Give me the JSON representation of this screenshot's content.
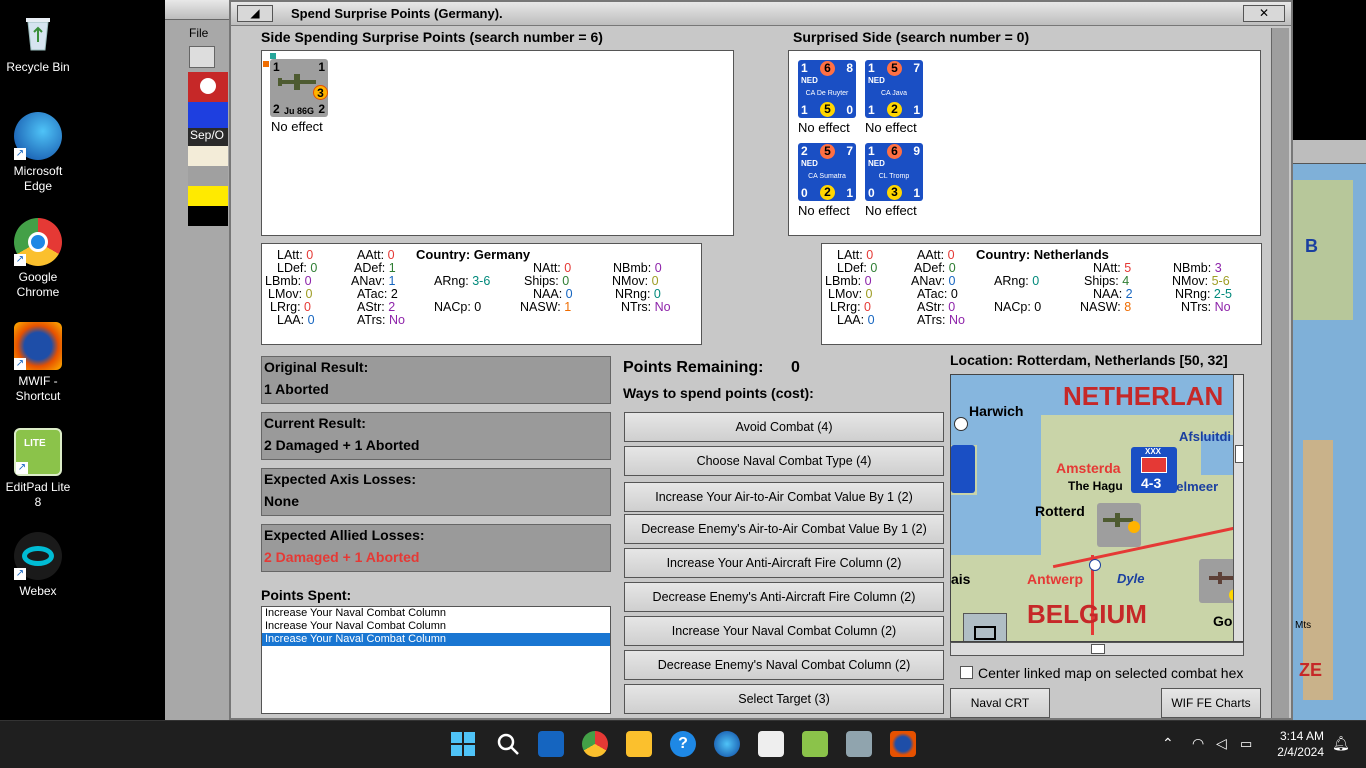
{
  "desktop": {
    "icons": [
      {
        "label": "Recycle Bin"
      },
      {
        "label": "Microsoft Edge"
      },
      {
        "label": "Google Chrome"
      },
      {
        "label": "MWIF - Shortcut"
      },
      {
        "label": "EditPad Lite 8"
      },
      {
        "label": "Webex"
      }
    ]
  },
  "left_window": {
    "menu": "File",
    "date": "Sep/O"
  },
  "dialog": {
    "title": "Spend Surprise Points (Germany).",
    "close": "✕",
    "side_spending": {
      "heading": "Side Spending Surprise Points (search number = 6)",
      "units": [
        {
          "tl": "1",
          "tr": "1",
          "bl": "2",
          "br": "2",
          "badge": "3",
          "name": "Ju 86G",
          "caption": "No effect"
        }
      ]
    },
    "surprised_side": {
      "heading": "Surprised Side (search number = 0)",
      "units": [
        {
          "tl": "1",
          "tm": "6",
          "tr": "8",
          "nat": "NED",
          "name": "CA De Ruyter",
          "bl": "1",
          "bm": "5",
          "br": "0",
          "caption": "No effect"
        },
        {
          "tl": "1",
          "tm": "5",
          "tr": "7",
          "nat": "NED",
          "name": "CA Java",
          "bl": "1",
          "bm": "2",
          "br": "1",
          "caption": "No effect"
        },
        {
          "tl": "2",
          "tm": "5",
          "tr": "7",
          "nat": "NED",
          "name": "CA Sumatra",
          "bl": "0",
          "bm": "2",
          "br": "1",
          "caption": "No effect"
        },
        {
          "tl": "1",
          "tm": "6",
          "tr": "9",
          "nat": "NED",
          "name": "CL Tromp",
          "bl": "0",
          "bm": "3",
          "br": "1",
          "caption": "No effect"
        }
      ]
    },
    "germany_stats": {
      "country": "Country: Germany",
      "LAtt": "0",
      "LDef": "0",
      "LBmb": "0",
      "LMov": "0",
      "LRrg": "0",
      "LAA": "0",
      "AAtt": "0",
      "ADef": "1",
      "ANav": "1",
      "ATac": "2",
      "AStr": "2",
      "ATrs": "No",
      "ARng": "3-6",
      "NACp": "0",
      "NAtt": "0",
      "Ships": "0",
      "NAA": "0",
      "NASW": "1",
      "NBmb": "0",
      "NMov": "0",
      "NRng": "0",
      "NTrs": "No"
    },
    "netherlands_stats": {
      "country": "Country: Netherlands",
      "LAtt": "0",
      "LDef": "0",
      "LBmb": "0",
      "LMov": "0",
      "LRrg": "0",
      "LAA": "0",
      "AAtt": "0",
      "ADef": "0",
      "ANav": "0",
      "ATac": "0",
      "AStr": "0",
      "ATrs": "No",
      "ARng": "0",
      "NACp": "0",
      "NAtt": "5",
      "Ships": "4",
      "NAA": "2",
      "NASW": "8",
      "NBmb": "3",
      "NMov": "5-6",
      "NRng": "2-5",
      "NTrs": "No"
    },
    "results": {
      "original_label": "Original Result:",
      "original_value": "1 Aborted",
      "current_label": "Current Result:",
      "current_value": "2 Damaged + 1 Aborted",
      "axis_label": "Expected Axis Losses:",
      "axis_value": "None",
      "allied_label": "Expected Allied Losses:",
      "allied_value": "2 Damaged + 1 Aborted"
    },
    "points_spent_label": "Points Spent:",
    "points_spent": [
      {
        "text": "Increase Your Naval Combat Column",
        "selected": false
      },
      {
        "text": "Increase Your Naval Combat Column",
        "selected": false
      },
      {
        "text": "Increase Your Naval Combat Column",
        "selected": true
      }
    ],
    "points_remaining_label": "Points Remaining:",
    "points_remaining_value": "0",
    "ways_label": "Ways to spend points (cost):",
    "options": [
      "Avoid Combat (4)",
      "Choose Naval Combat Type (4)",
      "Increase Your Air-to-Air Combat Value By 1 (2)",
      "Decrease Enemy's Air-to-Air Combat Value By 1 (2)",
      "Increase Your Anti-Aircraft Fire Column (2)",
      "Decrease Enemy's Anti-Aircraft Fire Column (2)",
      "Increase Your Naval Combat Column (2)",
      "Decrease Enemy's Naval Combat Column (2)",
      "Select Target (3)"
    ],
    "location": "Location: Rotterdam, Netherlands [50, 32]",
    "map_labels": {
      "netherlands": "NETHERLAN",
      "harwich": "Harwich",
      "afsluitdi": "Afsluitdi",
      "amsterdam": "Amsterda",
      "hague": "The Hagu",
      "ijsselmeer": "selmeer",
      "rotterdam": "Rotterd",
      "antwerp": "Antwerp",
      "dyle": "Dyle",
      "belgium": "BELGIUM",
      "ais": "ais",
      "go": "Go",
      "unit_43": "4-3",
      "unit_xxx": "XXX"
    },
    "center_checkbox_label": "Center linked map on selected combat hex",
    "center_checked": false,
    "naval_crt": "Naval CRT",
    "wif_charts": "WIF FE Charts"
  },
  "taskbar": {
    "time": "3:14 AM",
    "date": "2/4/2024"
  },
  "colors": {
    "ned_blue": "#1a4fc4",
    "german_grey": "#8a8a8a",
    "loss_red": "#e53935",
    "selection": "#1976d2"
  }
}
